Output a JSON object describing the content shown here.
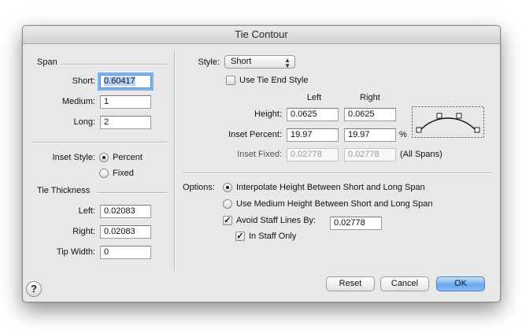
{
  "dialog": {
    "title": "Tie Contour"
  },
  "span": {
    "header": "Span",
    "short_label": "Short:",
    "short_value": "0.60417",
    "medium_label": "Medium:",
    "medium_value": "1",
    "long_label": "Long:",
    "long_value": "2"
  },
  "inset_style": {
    "label": "Inset Style:",
    "percent_label": "Percent",
    "percent_selected": true,
    "fixed_label": "Fixed",
    "fixed_selected": false
  },
  "tie_thickness": {
    "header": "Tie Thickness",
    "left_label": "Left:",
    "left_value": "0.02083",
    "right_label": "Right:",
    "right_value": "0.02083",
    "tip_width_label": "Tip Width:",
    "tip_width_value": "0"
  },
  "style": {
    "label": "Style:",
    "selected": "Short",
    "use_tie_end_style_label": "Use Tie End Style",
    "use_tie_end_style_checked": false
  },
  "grid": {
    "left_header": "Left",
    "right_header": "Right",
    "height_label": "Height:",
    "height_left": "0.0625",
    "height_right": "0.0625",
    "inset_percent_label": "Inset Percent:",
    "inset_percent_left": "19.97",
    "inset_percent_right": "19.97",
    "percent_unit": "%",
    "inset_fixed_label": "Inset Fixed:",
    "inset_fixed_left": "0.02778",
    "inset_fixed_right": "0.02778",
    "all_spans_label": "(All Spans)"
  },
  "options": {
    "label": "Options:",
    "interpolate_label": "Interpolate Height Between Short and Long Span",
    "interpolate_selected": true,
    "use_medium_label": "Use Medium Height Between Short and Long Span",
    "use_medium_selected": false,
    "avoid_staff_label": "Avoid Staff Lines By:",
    "avoid_staff_checked": true,
    "avoid_staff_value": "0.02778",
    "in_staff_only_label": "In Staff Only",
    "in_staff_only_checked": true
  },
  "buttons": {
    "reset": "Reset",
    "cancel": "Cancel",
    "ok": "OK",
    "help": "?"
  },
  "colors": {
    "default_button": "#6aa8ec",
    "focus_ring": "#7fb0e8",
    "dialog_bg": "#e8e8e8"
  }
}
